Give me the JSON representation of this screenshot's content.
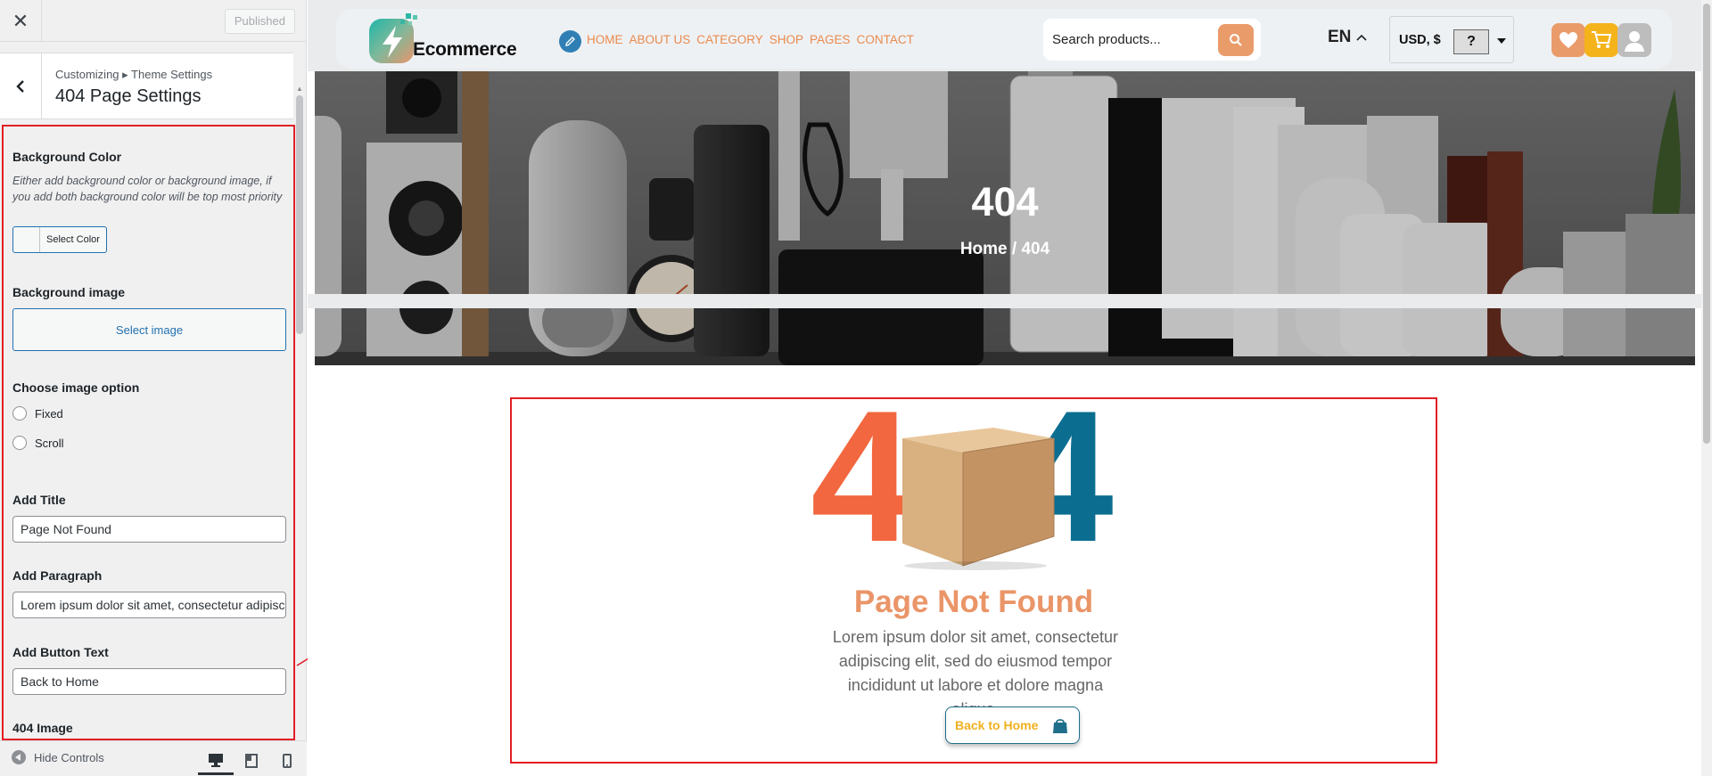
{
  "customizer": {
    "published_label": "Published",
    "breadcrumb": "Customizing ▸ Theme Settings",
    "section_title": "404 Page Settings",
    "bg_color": {
      "label": "Background Color",
      "description": "Either add background color or background image, if you add both background color will be top most priority",
      "button": "Select Color"
    },
    "bg_image": {
      "label": "Background image",
      "button": "Select image"
    },
    "image_option": {
      "label": "Choose image option",
      "options": [
        "Fixed",
        "Scroll"
      ]
    },
    "title_field": {
      "label": "Add Title",
      "value": "Page Not Found"
    },
    "paragraph_field": {
      "label": "Add Paragraph",
      "value": "Lorem ipsum dolor sit amet, consectetur adipiscing elit"
    },
    "button_field": {
      "label": "Add Button Text",
      "value": "Back to Home"
    },
    "image_section_label": "404 Image",
    "hide_controls": "Hide Controls"
  },
  "site": {
    "logo_text": "Ecommerce",
    "nav": [
      "HOME",
      "ABOUT US",
      "CATEGORY",
      "SHOP",
      "PAGES",
      "CONTACT"
    ],
    "search_placeholder": "Search products...",
    "language": "EN",
    "currency": "USD, $",
    "currency_flag": "?",
    "hero": {
      "title": "404",
      "breadcrumb": "Home / 404"
    },
    "error_digits": [
      "4",
      "4"
    ],
    "content": {
      "title": "Page Not Found",
      "paragraph": "Lorem ipsum dolor sit amet, consectetur adipiscing elit, sed do eiusmod tempor incididunt ut labore et dolore magna aliqua.",
      "button": "Back to Home"
    }
  },
  "colors": {
    "accent_orange": "#ea9568",
    "digit_left": "#f2673f",
    "digit_right": "#0b6e90",
    "button_text": "#f0b01e",
    "highlight": "#e31e24"
  }
}
